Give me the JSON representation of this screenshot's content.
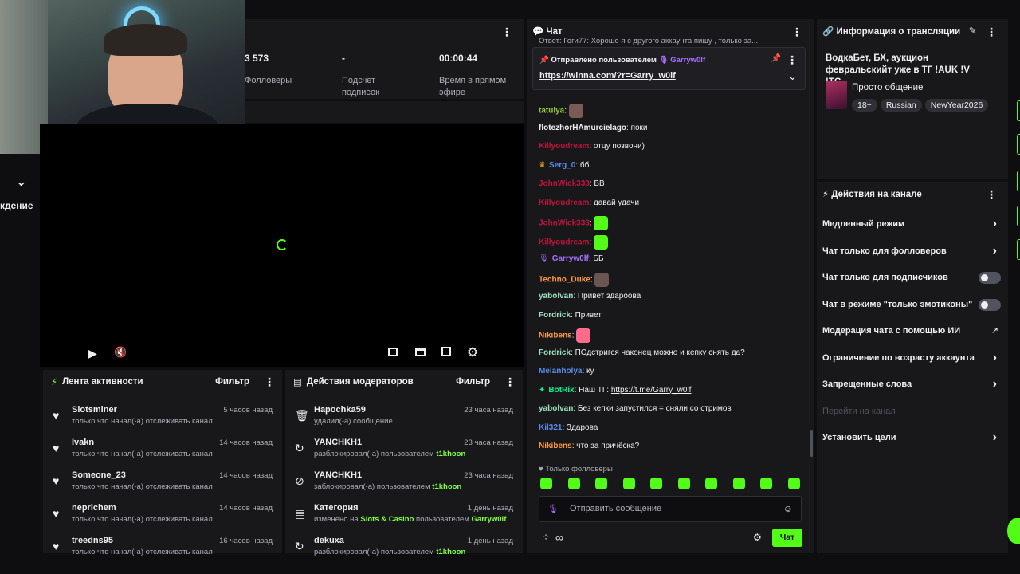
{
  "side": {
    "label": "кдение"
  },
  "stats": {
    "followers_value": "3 573",
    "followers_label": "Фолловеры",
    "subs_value": "-",
    "subs_label": "Подсчет подписок",
    "live_value": "00:00:44",
    "live_label": "Время в прямом эфире"
  },
  "activity": {
    "title": "Лента активности",
    "filter": "Фильтр",
    "items": [
      {
        "name": "Slotsminer",
        "desc": "только что начал(-а) отслеживать канал",
        "time": "5 часов назад"
      },
      {
        "name": "Ivakn",
        "desc": "только что начал(-а) отслеживать канал",
        "time": "14 часов назад"
      },
      {
        "name": "Someone_23",
        "desc": "только что начал(-а) отслеживать канал",
        "time": "14 часов назад"
      },
      {
        "name": "neprichem",
        "desc": "только что начал(-а) отслеживать канал",
        "time": "14 часов назад"
      },
      {
        "name": "treedns95",
        "desc": "только что начал(-а) отслеживать канал",
        "time": "16 часов назад"
      }
    ]
  },
  "modactions": {
    "title": "Действия модераторов",
    "filter": "Фильтр",
    "items": [
      {
        "name": "Hapochka59",
        "desc": "удалил(-а) сообщение",
        "time": "23 часа назад"
      },
      {
        "name": "YANCHKH1",
        "desc": "разблокировал(-а) пользователем",
        "target": "t1khoon",
        "time": "23 часа назад"
      },
      {
        "name": "YANCHKH1",
        "desc": "заблокировал(-а) пользователем",
        "target": "t1khoon",
        "time": "23 часа назад"
      },
      {
        "name": "Категория",
        "desc": "изменено на",
        "cat": "Slots & Casino",
        "desc2": "пользователем",
        "target": "Garryw0lf",
        "time": "1 день назад"
      },
      {
        "name": "dekuxa",
        "desc": "разблокировал(-а) пользователем",
        "target": "t1khoon",
        "time": "1 день назад"
      }
    ]
  },
  "chat": {
    "title": "Чат",
    "pinned_by": "Отправлено пользователем",
    "pinned_user": "Garryw0lf",
    "pinned_link": "https://winna.com/?r=Garry_w0lf",
    "top_cut": "Ответ: Гоги77: Хорошо я с другого аккаунта пишу , только за...",
    "messages": [
      {
        "user": "tatulya",
        "text": "",
        "color": "#9acd32"
      },
      {
        "user": "flotezhorHAmurcielago",
        "text": "поки",
        "color": "#efeff1"
      },
      {
        "user": "Killyoudream",
        "text": "отцу позвони)",
        "color": "#c0143c"
      },
      {
        "user": "Serg_0",
        "text": "бб",
        "color": "#5b8def"
      },
      {
        "user": "JohnWick333",
        "text": "BB",
        "color": "#c0143c"
      },
      {
        "user": "Killyoudream",
        "text": "давай удачи",
        "color": "#c0143c"
      },
      {
        "user": "JohnWick333",
        "text": "",
        "color": "#c0143c"
      },
      {
        "user": "Killyoudream",
        "text": "",
        "color": "#c0143c"
      },
      {
        "user": "Garryw0lf",
        "text": "ББ",
        "color": "#a970ff"
      },
      {
        "user": "Techno_Duke",
        "text": "",
        "color": "#ff9a3c"
      },
      {
        "user": "yabolvan",
        "text": "Привет здароова",
        "color": "#9de0c0"
      },
      {
        "user": "Fordrick",
        "text": "Привет",
        "color": "#9de0c0"
      },
      {
        "user": "Nikibens",
        "text": "",
        "color": "#ff9a3c"
      },
      {
        "user": "Fordrick",
        "text": "ПОдстригся наконец можно и кепку снять да?",
        "color": "#9de0c0"
      },
      {
        "user": "Melanholya",
        "text": "ку",
        "color": "#5b8def"
      },
      {
        "user": "BotRix",
        "text": "Наш ТГ:",
        "link": "https://t.me/Garry_w0lf",
        "color": "#00f593"
      },
      {
        "user": "yabolvan",
        "text": "Без кепки запустился = сняли со стримов",
        "color": "#9de0c0"
      },
      {
        "user": "Kil321",
        "text": "Здарова",
        "color": "#5b8def"
      },
      {
        "user": "Nikibens",
        "text": "что за причёска?",
        "color": "#ff9a3c"
      }
    ],
    "followers_only": "Только фолловеры",
    "input_placeholder": "Отправить сообщение",
    "send": "Чат"
  },
  "info": {
    "title": "Информация о трансляции",
    "stream_title": "ВодкаБет, БХ, аукцион февральскийт уже в ТГ !AUK !V !TG",
    "category": "Просто общение",
    "tags": [
      "18+",
      "Russian",
      "NewYear2026"
    ]
  },
  "actions": {
    "title": "Действия на канале",
    "items": [
      {
        "label": "Медленный режим",
        "type": "chevron"
      },
      {
        "label": "Чат только для фолловеров",
        "type": "chevron"
      },
      {
        "label": "Чат только для подписчиков",
        "type": "toggle"
      },
      {
        "label": "Чат в режиме \"только эмотиконы\"",
        "type": "toggle"
      },
      {
        "label": "Модерация чата с помощью ИИ",
        "type": "external"
      },
      {
        "label": "Ограничение по возрасту аккаунта",
        "type": "chevron"
      },
      {
        "label": "Запрещенные слова",
        "type": "chevron"
      },
      {
        "label": "Перейти на канал",
        "type": "disabled"
      },
      {
        "label": "Установить цели",
        "type": "chevron"
      }
    ]
  },
  "colors": {
    "accent": "#53fc18",
    "panel": "#18181b",
    "bg": "#0e0e10"
  }
}
